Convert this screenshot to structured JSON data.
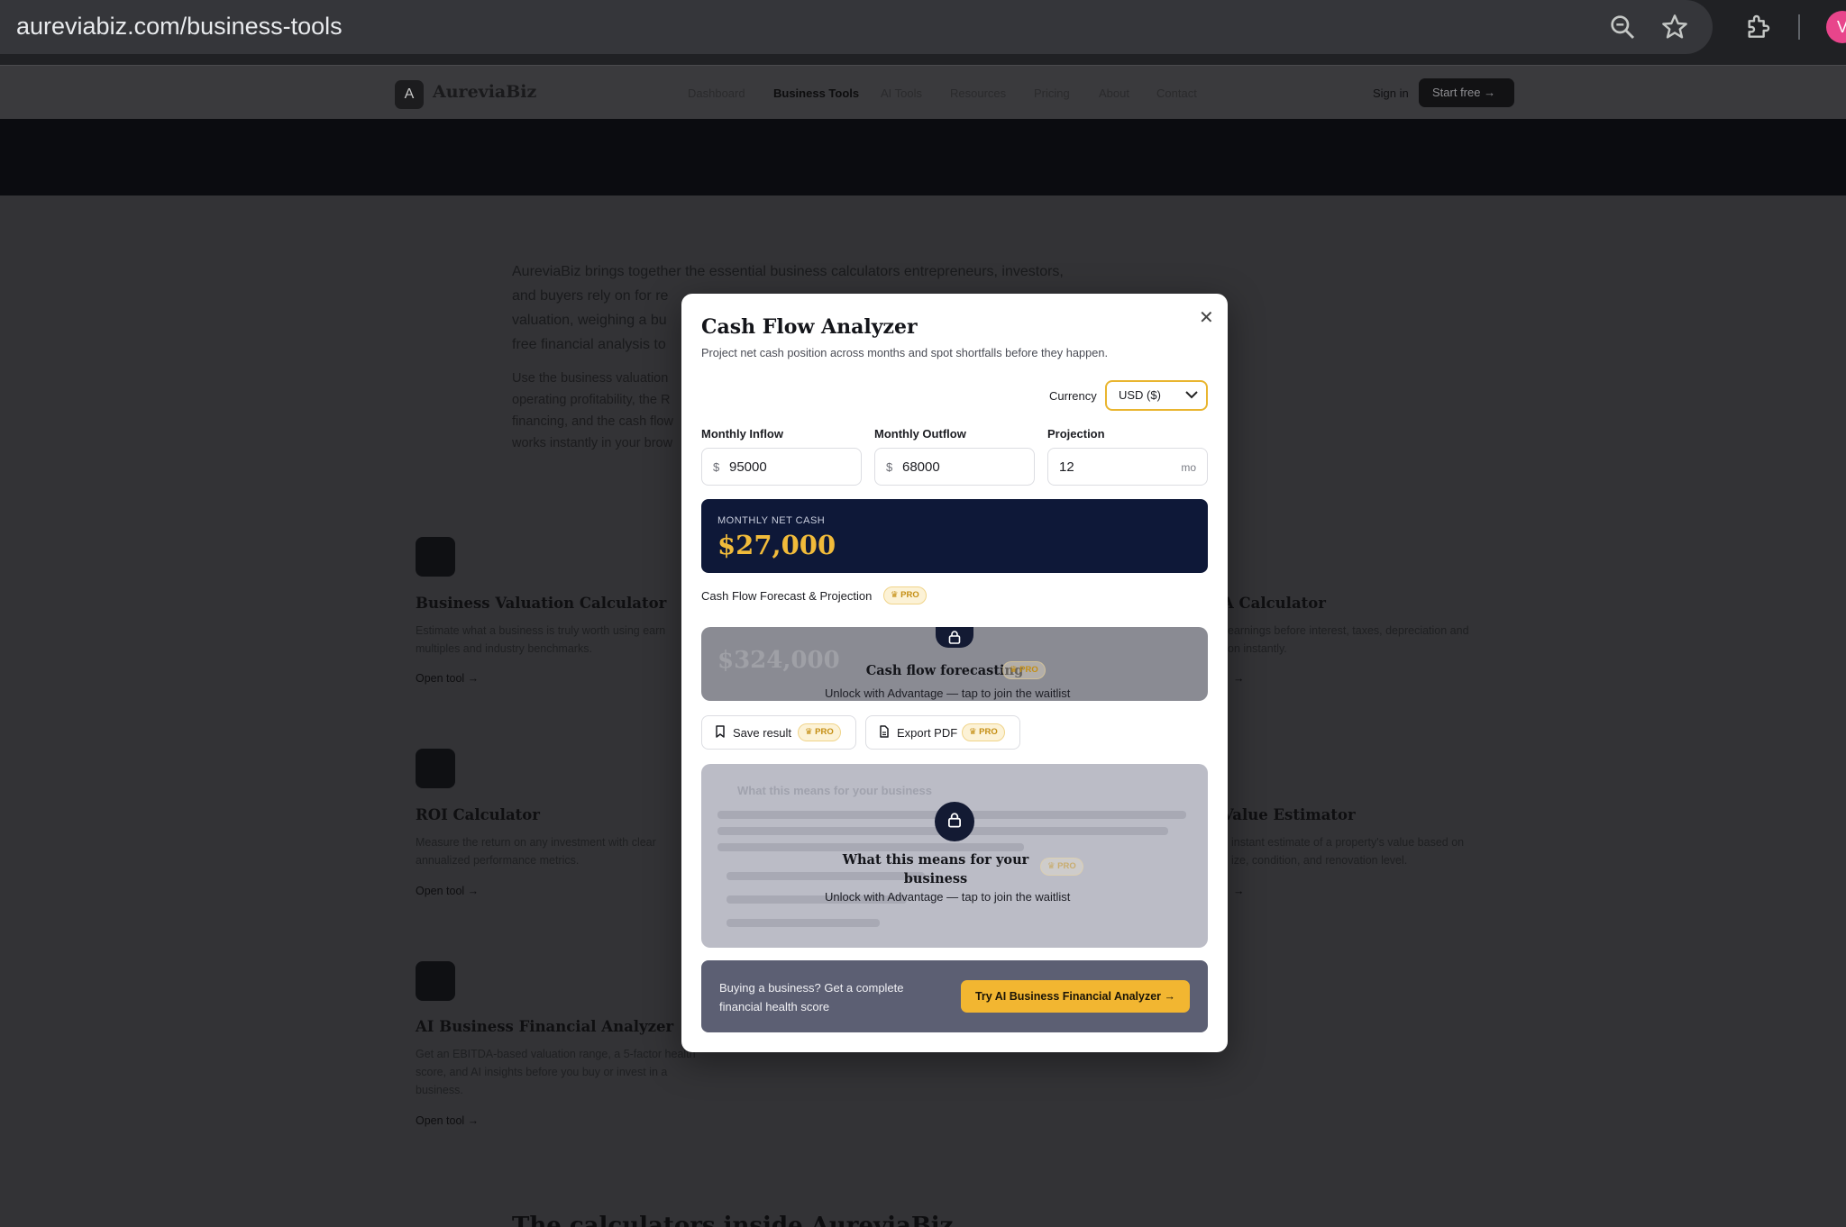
{
  "browser": {
    "url": "aureviabiz.com/business-tools",
    "avatar_letter": "V"
  },
  "header": {
    "logo_letter": "A",
    "brand": "AureviaBiz",
    "nav": [
      "Dashboard",
      "Business Tools",
      "AI Tools",
      "Resources",
      "Pricing",
      "About",
      "Contact"
    ],
    "sign_in": "Sign in",
    "start_free": "Start free →"
  },
  "background": {
    "intro_lines": [
      "AureviaBiz brings together the essential business calculators entrepreneurs, investors,",
      "and buyers rely on for re",
      "valuation, weighing a bu",
      "free financial analysis to"
    ],
    "use_lines": [
      "Use the business valuation",
      "operating profitability, the R",
      "financing, and the cash flow",
      "works instantly in your brow"
    ],
    "tools": [
      {
        "title": "Business Valuation Calculator",
        "desc1": "Estimate what a business is truly worth using earn",
        "desc2": "multiples and industry benchmarks.",
        "link": "Open tool →"
      },
      {
        "title": "ROI Calculator",
        "desc1": "Measure the return on any investment with clear",
        "desc2": "annualized performance metrics.",
        "link": "Open tool →"
      },
      {
        "title": "AI Business Financial Analyzer",
        "desc1": "Get an EBITDA-based valuation range, a 5-factor health",
        "desc2": "score, and AI insights before you buy or invest in a",
        "desc3": "business.",
        "link": "Open tool →"
      },
      {
        "title": "A Calculator",
        "desc1": "earnings before interest, taxes, depreciation and",
        "desc2": "on instantly.",
        "link": "→"
      },
      {
        "title": "Value Estimator",
        "desc1": "instant estimate of a property's value based on",
        "desc2": "ize, condition, and renovation level.",
        "link": "→"
      }
    ],
    "bottom_heading": "The calculators inside AureviaBiz"
  },
  "modal": {
    "title": "Cash Flow Analyzer",
    "subtitle": "Project net cash position across months and spot shortfalls before they happen.",
    "currency_label": "Currency",
    "currency_value": "USD ($)",
    "fields": [
      {
        "label": "Monthly Inflow",
        "prefix": "$",
        "value": "95000"
      },
      {
        "label": "Monthly Outflow",
        "prefix": "$",
        "value": "68000"
      },
      {
        "label": "Projection",
        "value": "12",
        "suffix": "mo"
      }
    ],
    "net_label": "MONTHLY NET CASH",
    "net_value": "$27,000",
    "forecast_label": "Cash Flow Forecast & Projection",
    "pro": "PRO",
    "forecast_ghost_value": "$324,000",
    "forecast_lock_title": "Cash flow forecasting",
    "unlock_text": "Unlock with Advantage — tap to join the waitlist",
    "save_label": "Save result",
    "export_label": "Export PDF",
    "insight_ghost_title": "What this means for your business",
    "insight_lock_title_1": "What this means for your",
    "insight_lock_title_2": "business",
    "promo_text": "Buying a business? Get a complete financial health score",
    "promo_button": "Try AI Business Financial Analyzer →"
  }
}
